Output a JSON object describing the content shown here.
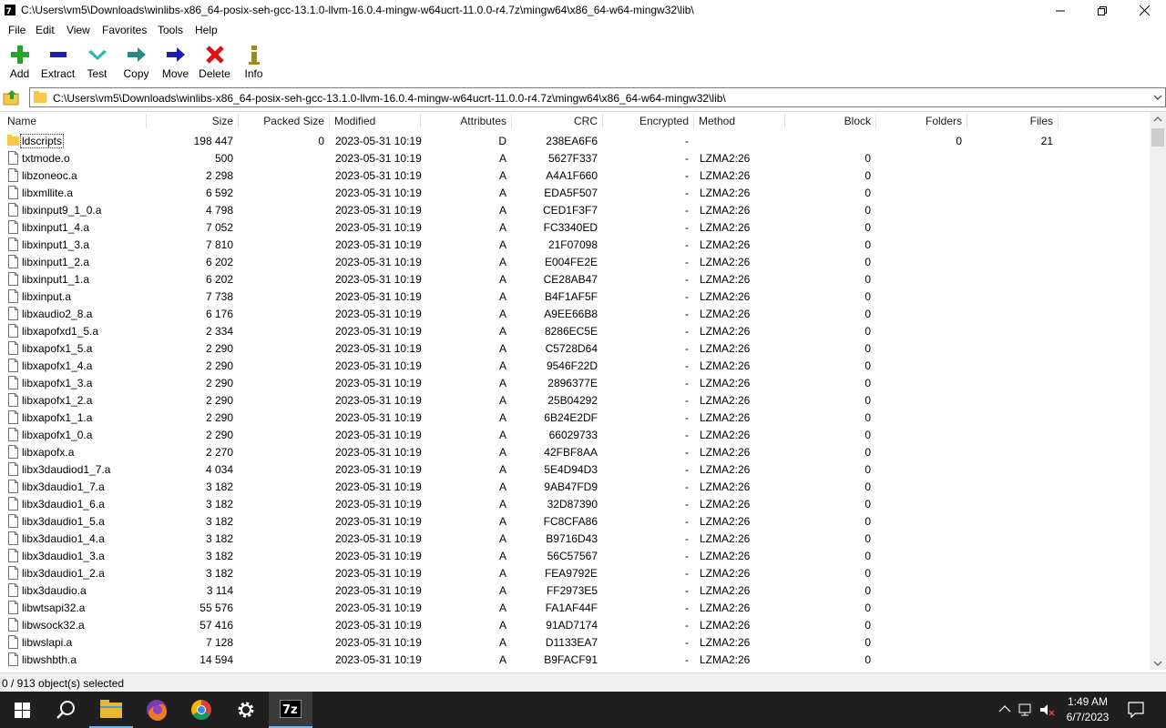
{
  "window": {
    "title": "C:\\Users\\vm5\\Downloads\\winlibs-x86_64-posix-seh-gcc-13.1.0-llvm-16.0.4-mingw-w64ucrt-11.0.0-r4.7z\\mingw64\\x86_64-w64-mingw32\\lib\\"
  },
  "menu": [
    "File",
    "Edit",
    "View",
    "Favorites",
    "Tools",
    "Help"
  ],
  "toolbar": {
    "add": "Add",
    "extract": "Extract",
    "test": "Test",
    "copy": "Copy",
    "move": "Move",
    "delete": "Delete",
    "info": "Info"
  },
  "address": {
    "path": "C:\\Users\\vm5\\Downloads\\winlibs-x86_64-posix-seh-gcc-13.1.0-llvm-16.0.4-mingw-w64ucrt-11.0.0-r4.7z\\mingw64\\x86_64-w64-mingw32\\lib\\"
  },
  "columns": [
    "Name",
    "Size",
    "Packed Size",
    "Modified",
    "Attributes",
    "CRC",
    "Encrypted",
    "Method",
    "Block",
    "Folders",
    "Files"
  ],
  "rows": [
    {
      "name": "ldscripts",
      "size": "198 447",
      "packed": "0",
      "modified": "2023-05-31 10:19",
      "attr": "D",
      "crc": "238EA6F6",
      "enc": "-",
      "method": "",
      "block": "",
      "folders": "0",
      "files": "21",
      "folder": true
    },
    {
      "name": "txtmode.o",
      "size": "500",
      "packed": "",
      "modified": "2023-05-31 10:19",
      "attr": "A",
      "crc": "5627F337",
      "enc": "-",
      "method": "LZMA2:26",
      "block": "0",
      "folders": "",
      "files": ""
    },
    {
      "name": "libzoneoc.a",
      "size": "2 298",
      "packed": "",
      "modified": "2023-05-31 10:19",
      "attr": "A",
      "crc": "A4A1F660",
      "enc": "-",
      "method": "LZMA2:26",
      "block": "0",
      "folders": "",
      "files": ""
    },
    {
      "name": "libxmllite.a",
      "size": "6 592",
      "packed": "",
      "modified": "2023-05-31 10:19",
      "attr": "A",
      "crc": "EDA5F507",
      "enc": "-",
      "method": "LZMA2:26",
      "block": "0",
      "folders": "",
      "files": ""
    },
    {
      "name": "libxinput9_1_0.a",
      "size": "4 798",
      "packed": "",
      "modified": "2023-05-31 10:19",
      "attr": "A",
      "crc": "CED1F3F7",
      "enc": "-",
      "method": "LZMA2:26",
      "block": "0",
      "folders": "",
      "files": ""
    },
    {
      "name": "libxinput1_4.a",
      "size": "7 052",
      "packed": "",
      "modified": "2023-05-31 10:19",
      "attr": "A",
      "crc": "FC3340ED",
      "enc": "-",
      "method": "LZMA2:26",
      "block": "0",
      "folders": "",
      "files": ""
    },
    {
      "name": "libxinput1_3.a",
      "size": "7 810",
      "packed": "",
      "modified": "2023-05-31 10:19",
      "attr": "A",
      "crc": "21F07098",
      "enc": "-",
      "method": "LZMA2:26",
      "block": "0",
      "folders": "",
      "files": ""
    },
    {
      "name": "libxinput1_2.a",
      "size": "6 202",
      "packed": "",
      "modified": "2023-05-31 10:19",
      "attr": "A",
      "crc": "E004FE2E",
      "enc": "-",
      "method": "LZMA2:26",
      "block": "0",
      "folders": "",
      "files": ""
    },
    {
      "name": "libxinput1_1.a",
      "size": "6 202",
      "packed": "",
      "modified": "2023-05-31 10:19",
      "attr": "A",
      "crc": "CE28AB47",
      "enc": "-",
      "method": "LZMA2:26",
      "block": "0",
      "folders": "",
      "files": ""
    },
    {
      "name": "libxinput.a",
      "size": "7 738",
      "packed": "",
      "modified": "2023-05-31 10:19",
      "attr": "A",
      "crc": "B4F1AF5F",
      "enc": "-",
      "method": "LZMA2:26",
      "block": "0",
      "folders": "",
      "files": ""
    },
    {
      "name": "libxaudio2_8.a",
      "size": "6 176",
      "packed": "",
      "modified": "2023-05-31 10:19",
      "attr": "A",
      "crc": "A9EE66B8",
      "enc": "-",
      "method": "LZMA2:26",
      "block": "0",
      "folders": "",
      "files": ""
    },
    {
      "name": "libxapofxd1_5.a",
      "size": "2 334",
      "packed": "",
      "modified": "2023-05-31 10:19",
      "attr": "A",
      "crc": "8286EC5E",
      "enc": "-",
      "method": "LZMA2:26",
      "block": "0",
      "folders": "",
      "files": ""
    },
    {
      "name": "libxapofx1_5.a",
      "size": "2 290",
      "packed": "",
      "modified": "2023-05-31 10:19",
      "attr": "A",
      "crc": "C5728D64",
      "enc": "-",
      "method": "LZMA2:26",
      "block": "0",
      "folders": "",
      "files": ""
    },
    {
      "name": "libxapofx1_4.a",
      "size": "2 290",
      "packed": "",
      "modified": "2023-05-31 10:19",
      "attr": "A",
      "crc": "9546F22D",
      "enc": "-",
      "method": "LZMA2:26",
      "block": "0",
      "folders": "",
      "files": ""
    },
    {
      "name": "libxapofx1_3.a",
      "size": "2 290",
      "packed": "",
      "modified": "2023-05-31 10:19",
      "attr": "A",
      "crc": "2896377E",
      "enc": "-",
      "method": "LZMA2:26",
      "block": "0",
      "folders": "",
      "files": ""
    },
    {
      "name": "libxapofx1_2.a",
      "size": "2 290",
      "packed": "",
      "modified": "2023-05-31 10:19",
      "attr": "A",
      "crc": "25B04292",
      "enc": "-",
      "method": "LZMA2:26",
      "block": "0",
      "folders": "",
      "files": ""
    },
    {
      "name": "libxapofx1_1.a",
      "size": "2 290",
      "packed": "",
      "modified": "2023-05-31 10:19",
      "attr": "A",
      "crc": "6B24E2DF",
      "enc": "-",
      "method": "LZMA2:26",
      "block": "0",
      "folders": "",
      "files": ""
    },
    {
      "name": "libxapofx1_0.a",
      "size": "2 290",
      "packed": "",
      "modified": "2023-05-31 10:19",
      "attr": "A",
      "crc": "66029733",
      "enc": "-",
      "method": "LZMA2:26",
      "block": "0",
      "folders": "",
      "files": ""
    },
    {
      "name": "libxapofx.a",
      "size": "2 270",
      "packed": "",
      "modified": "2023-05-31 10:19",
      "attr": "A",
      "crc": "42FBF8AA",
      "enc": "-",
      "method": "LZMA2:26",
      "block": "0",
      "folders": "",
      "files": ""
    },
    {
      "name": "libx3daudiod1_7.a",
      "size": "4 034",
      "packed": "",
      "modified": "2023-05-31 10:19",
      "attr": "A",
      "crc": "5E4D94D3",
      "enc": "-",
      "method": "LZMA2:26",
      "block": "0",
      "folders": "",
      "files": ""
    },
    {
      "name": "libx3daudio1_7.a",
      "size": "3 182",
      "packed": "",
      "modified": "2023-05-31 10:19",
      "attr": "A",
      "crc": "9AB47FD9",
      "enc": "-",
      "method": "LZMA2:26",
      "block": "0",
      "folders": "",
      "files": ""
    },
    {
      "name": "libx3daudio1_6.a",
      "size": "3 182",
      "packed": "",
      "modified": "2023-05-31 10:19",
      "attr": "A",
      "crc": "32D87390",
      "enc": "-",
      "method": "LZMA2:26",
      "block": "0",
      "folders": "",
      "files": ""
    },
    {
      "name": "libx3daudio1_5.a",
      "size": "3 182",
      "packed": "",
      "modified": "2023-05-31 10:19",
      "attr": "A",
      "crc": "FC8CFA86",
      "enc": "-",
      "method": "LZMA2:26",
      "block": "0",
      "folders": "",
      "files": ""
    },
    {
      "name": "libx3daudio1_4.a",
      "size": "3 182",
      "packed": "",
      "modified": "2023-05-31 10:19",
      "attr": "A",
      "crc": "B9716D43",
      "enc": "-",
      "method": "LZMA2:26",
      "block": "0",
      "folders": "",
      "files": ""
    },
    {
      "name": "libx3daudio1_3.a",
      "size": "3 182",
      "packed": "",
      "modified": "2023-05-31 10:19",
      "attr": "A",
      "crc": "56C57567",
      "enc": "-",
      "method": "LZMA2:26",
      "block": "0",
      "folders": "",
      "files": ""
    },
    {
      "name": "libx3daudio1_2.a",
      "size": "3 182",
      "packed": "",
      "modified": "2023-05-31 10:19",
      "attr": "A",
      "crc": "FEA9792E",
      "enc": "-",
      "method": "LZMA2:26",
      "block": "0",
      "folders": "",
      "files": ""
    },
    {
      "name": "libx3daudio.a",
      "size": "3 114",
      "packed": "",
      "modified": "2023-05-31 10:19",
      "attr": "A",
      "crc": "FF2973E5",
      "enc": "-",
      "method": "LZMA2:26",
      "block": "0",
      "folders": "",
      "files": ""
    },
    {
      "name": "libwtsapi32.a",
      "size": "55 576",
      "packed": "",
      "modified": "2023-05-31 10:19",
      "attr": "A",
      "crc": "FA1AF44F",
      "enc": "-",
      "method": "LZMA2:26",
      "block": "0",
      "folders": "",
      "files": ""
    },
    {
      "name": "libwsock32.a",
      "size": "57 416",
      "packed": "",
      "modified": "2023-05-31 10:19",
      "attr": "A",
      "crc": "91AD7174",
      "enc": "-",
      "method": "LZMA2:26",
      "block": "0",
      "folders": "",
      "files": ""
    },
    {
      "name": "libwslapi.a",
      "size": "7 128",
      "packed": "",
      "modified": "2023-05-31 10:19",
      "attr": "A",
      "crc": "D1133EA7",
      "enc": "-",
      "method": "LZMA2:26",
      "block": "0",
      "folders": "",
      "files": ""
    },
    {
      "name": "libwshbth.a",
      "size": "14 594",
      "packed": "",
      "modified": "2023-05-31 10:19",
      "attr": "A",
      "crc": "B9FACF91",
      "enc": "-",
      "method": "LZMA2:26",
      "block": "0",
      "folders": "",
      "files": ""
    }
  ],
  "status": "0 / 913 object(s) selected",
  "taskbar": {
    "time": "1:49 AM",
    "date": "6/7/2023",
    "apps": [
      "start-icon",
      "search-icon",
      "file-explorer-icon",
      "firefox-icon",
      "chrome-icon",
      "settings-icon",
      "7zip-icon"
    ]
  },
  "colors": {
    "add": "#2aa12a",
    "extract": "#1c1cb4",
    "test": "#2fb5b5",
    "copy": "#2a8a8a",
    "move": "#1c1cb4",
    "delete": "#e01010",
    "info": "#9a8a20",
    "folder": "#f5c84a"
  }
}
